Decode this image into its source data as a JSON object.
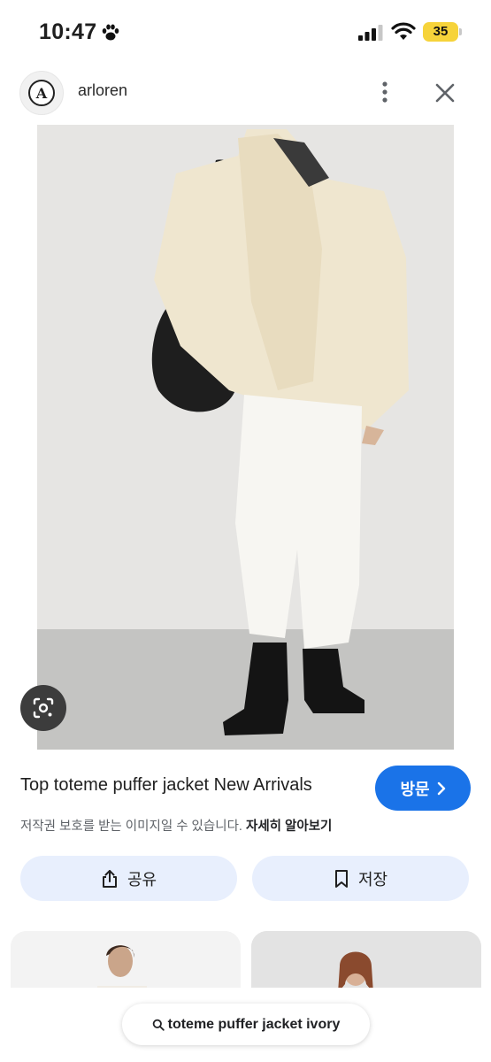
{
  "status_bar": {
    "time": "10:47",
    "battery": "35",
    "icons": [
      "paw-icon",
      "signal-icon",
      "wifi-icon",
      "battery-icon"
    ]
  },
  "header": {
    "logo_letter": "A",
    "site_name": "arloren",
    "icons": [
      "more-vert-icon",
      "close-icon"
    ]
  },
  "result": {
    "title": "Top toteme puffer jacket New Arrivals",
    "visit_label": "방문",
    "copyright_text": "저작권 보호를 받는 이미지일 수 있습니다.",
    "learn_more": "자세히 알아보기",
    "share_label": "공유",
    "save_label": "저장"
  },
  "search": {
    "query": "toteme puffer jacket ivory"
  },
  "colors": {
    "accent": "#1a73e8",
    "chip_bg": "#e8effd",
    "battery": "#f6d33a"
  }
}
